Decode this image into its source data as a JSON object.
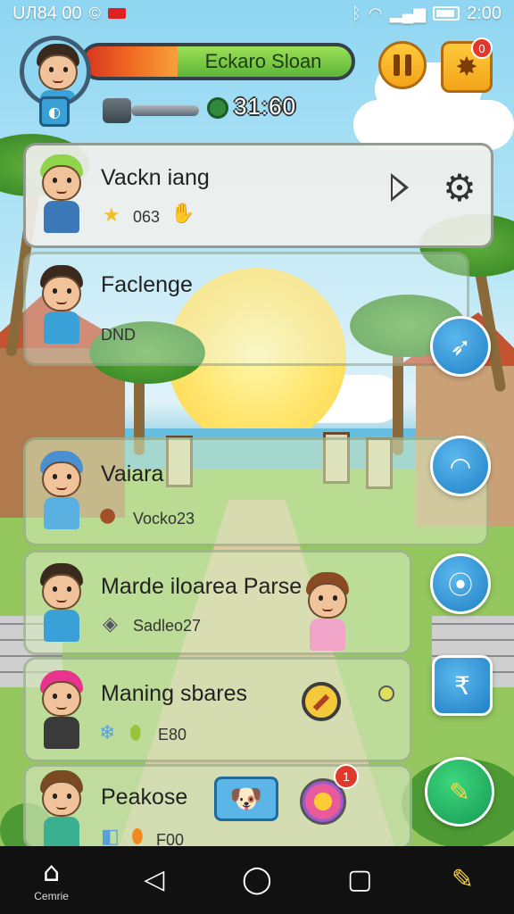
{
  "status_bar": {
    "left_text": "UЛ84 00",
    "time": "2:00",
    "icons": [
      "copyright-icon",
      "notification-icon",
      "bluetooth-icon",
      "wifi-icon",
      "signal-icon",
      "battery-icon"
    ]
  },
  "hud": {
    "player_name": "Eckaro Sloan",
    "xp_fraction": 0.35,
    "timer": "31:60",
    "pause_icon": "pause-icon",
    "alert_badge": "0",
    "colors": {
      "xp_red": "#d8331f",
      "xp_green": "#5db538",
      "button_gold": "#f3a41a"
    }
  },
  "cards": [
    {
      "title": "Vackn iang",
      "sub": "063"
    },
    {
      "title": "Faclenge",
      "sub": "DND"
    },
    {
      "title": "Vaiara",
      "sub": "Vocko23"
    },
    {
      "title": "Marde iloarea Parse",
      "sub": "Sadleo27"
    },
    {
      "title": "Maning sbares",
      "sub": "E80"
    },
    {
      "title": "Peakose",
      "sub": "F00"
    }
  ],
  "notification_badge": "1",
  "nav": {
    "home_label": "Cemrie",
    "items": [
      "home-icon",
      "back-icon",
      "home-circle-icon",
      "recents-icon",
      "pencil-icon"
    ]
  }
}
